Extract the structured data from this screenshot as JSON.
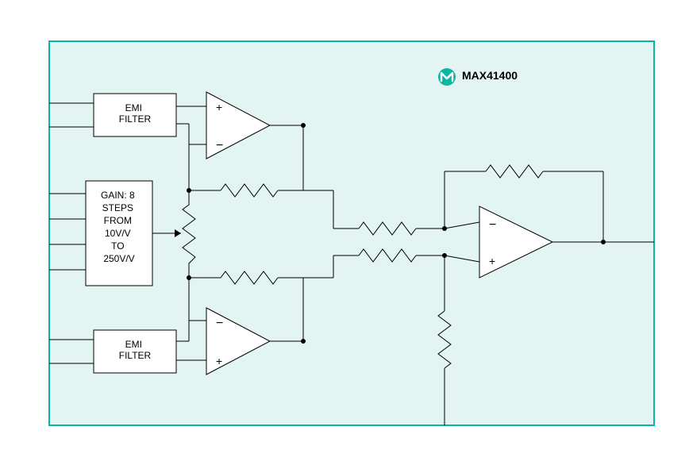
{
  "part_number": "MAX41400",
  "blocks": {
    "emi_top": "EMI\nFILTER",
    "emi_bot": "EMI\nFILTER",
    "gain": "GAIN: 8\nSTEPS\nFROM\n10V/V\nTO\n250V/V"
  },
  "colors": {
    "bg": "#e2f5f2",
    "border": "#0bb6a1",
    "stroke": "#000000",
    "logo": "#0bb6a1"
  }
}
